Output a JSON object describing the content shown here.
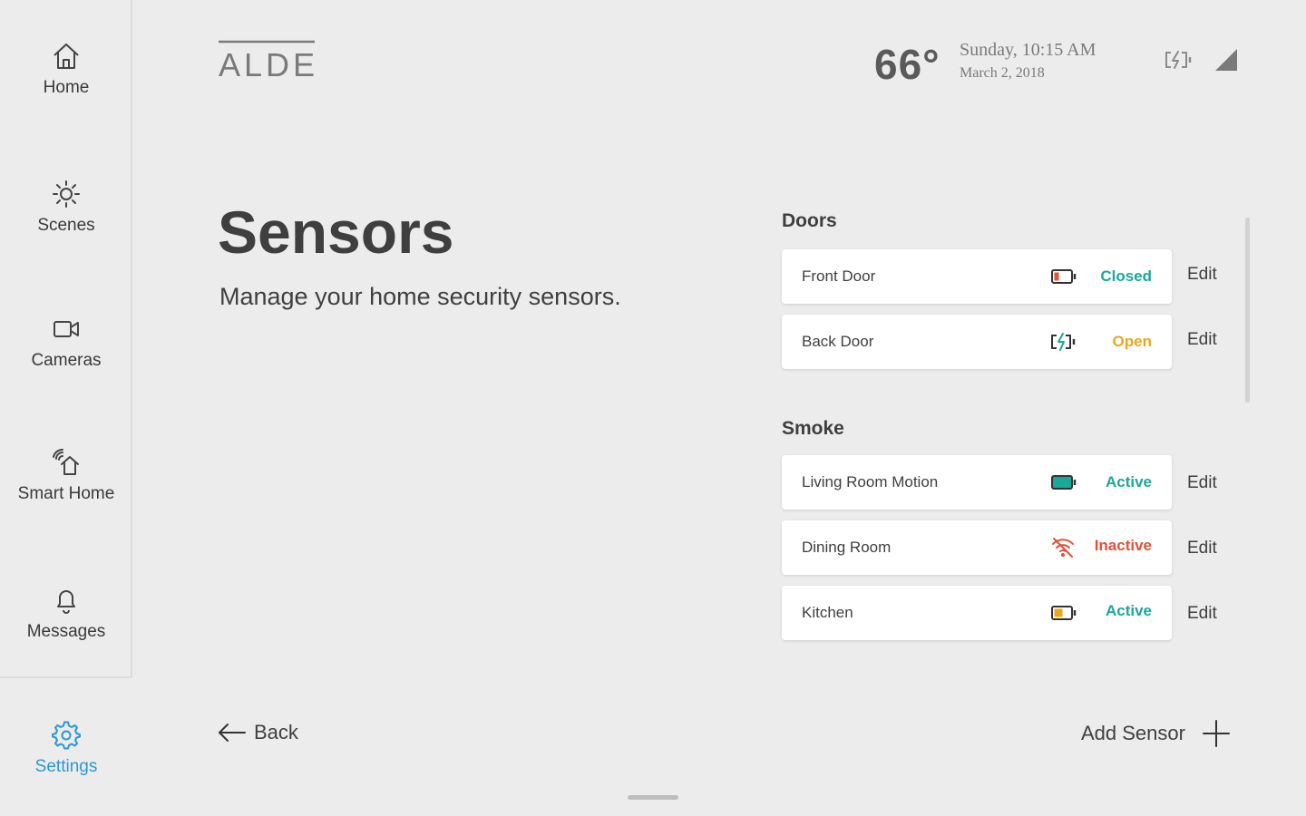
{
  "nav": {
    "items": [
      {
        "label": "Home",
        "icon": "home-icon"
      },
      {
        "label": "Scenes",
        "icon": "sun-icon"
      },
      {
        "label": "Cameras",
        "icon": "camera-icon"
      },
      {
        "label": "Smart Home",
        "icon": "smart-home-icon"
      },
      {
        "label": "Messages",
        "icon": "bell-icon"
      }
    ],
    "settings": {
      "label": "Settings",
      "icon": "gear-icon",
      "active": true
    }
  },
  "header": {
    "logo": "ALDER",
    "temperature": "66°",
    "day_time": "Sunday, 10:15 AM",
    "date": "March 2, 2018",
    "battery_icon": "battery-charging-icon",
    "signal_icon": "signal-icon"
  },
  "page": {
    "title": "Sensors",
    "subtitle": "Manage your home security sensors."
  },
  "sections": [
    {
      "title": "Doors",
      "sensors": [
        {
          "name": "Front Door",
          "icon": "battery-low-icon",
          "status": "Closed",
          "status_color": "#1aa89a",
          "edit": "Edit"
        },
        {
          "name": "Back Door",
          "icon": "battery-charging-icon",
          "status": "Open",
          "status_color": "#e8a819",
          "edit": "Edit"
        }
      ]
    },
    {
      "title": "Smoke",
      "sensors": [
        {
          "name": "Living Room Motion",
          "icon": "battery-full-icon",
          "status": "Active",
          "status_color": "#1aa89a",
          "edit": "Edit"
        },
        {
          "name": "Dining Room",
          "icon": "wifi-off-icon",
          "status": "Inactive",
          "status_color": "#e0503a",
          "edit": "Edit"
        },
        {
          "name": "Kitchen",
          "icon": "battery-half-icon",
          "status": "Active",
          "status_color": "#1aa89a",
          "edit": "Edit"
        }
      ]
    }
  ],
  "footer": {
    "back_label": "Back",
    "add_label": "Add Sensor"
  },
  "colors": {
    "accent": "#2b98d3",
    "teal": "#1aa89a",
    "amber": "#e8a819",
    "red": "#e0503a"
  }
}
